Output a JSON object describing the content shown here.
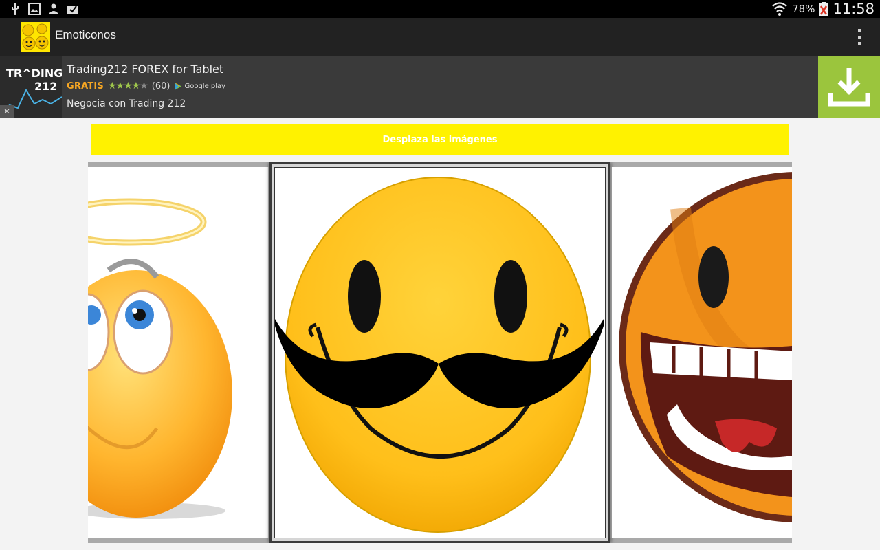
{
  "status_bar": {
    "left_icons": [
      "usb-icon",
      "image-icon",
      "person-icon",
      "mail-check-icon"
    ],
    "battery_percent": "78%",
    "time": "11:58",
    "right_icons": [
      "wifi-icon",
      "battery-icon"
    ]
  },
  "action_bar": {
    "title": "Emoticonos",
    "menu_icon": "overflow-menu-icon"
  },
  "ad": {
    "title": "Trading212 FOREX for Tablet",
    "price": "GRATIS",
    "rating": 4,
    "reviews": "(60)",
    "store_label": "Google play",
    "subtitle": "Negocia con Trading 212",
    "logo_text_top": "TR^DING",
    "logo_text_bottom": "212",
    "close_label": "✕",
    "download_color": "#9bc53d"
  },
  "hint": {
    "text": "Desplaza las imágenes",
    "bg_color": "#fff200"
  },
  "gallery": {
    "images": [
      "angel-emoji",
      "mustache-smiley",
      "laughing-emoji"
    ],
    "selected_index": 1
  }
}
